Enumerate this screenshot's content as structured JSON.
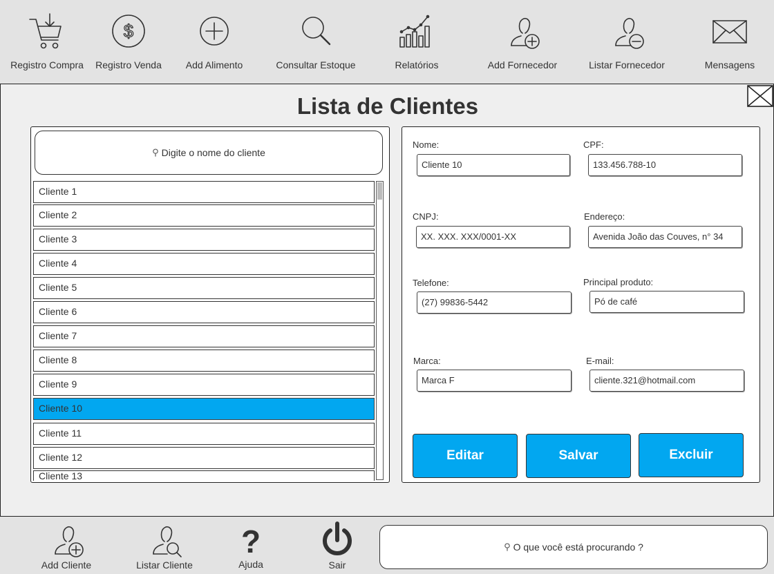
{
  "toolbar": {
    "items": [
      {
        "label": "Registro Compra",
        "icon": "cart-download-icon"
      },
      {
        "label": "Registro Venda",
        "icon": "dollar-circle-icon"
      },
      {
        "label": "Add Alimento",
        "icon": "plus-circle-icon"
      },
      {
        "label": "Consultar Estoque",
        "icon": "search-icon"
      },
      {
        "label": "Relatórios",
        "icon": "bar-chart-icon"
      },
      {
        "label": "Add Fornecedor",
        "icon": "user-add-icon"
      },
      {
        "label": "Listar Fornecedor",
        "icon": "user-remove-icon"
      },
      {
        "label": "Mensagens",
        "icon": "envelope-icon"
      }
    ]
  },
  "main": {
    "title": "Lista de Clientes",
    "close_icon": "close-envelope-icon"
  },
  "client_list": {
    "search_placeholder": "Digite o nome do cliente",
    "search_icon": "🔍",
    "items": [
      "Cliente 1",
      "Cliente 2",
      "Cliente 3",
      "Cliente 4",
      "Cliente 5",
      "Cliente 6",
      "Cliente 7",
      "Cliente 8",
      "Cliente 9",
      "Cliente 10",
      "Cliente 11",
      "Cliente 12",
      "Cliente 13"
    ],
    "selected": "Cliente 10"
  },
  "detail": {
    "nome_label": "Nome:",
    "nome_value": "Cliente 10",
    "cpf_label": "CPF:",
    "cpf_value": "133.456.788-10",
    "cnpj_label": "CNPJ:",
    "cnpj_value": "XX. XXX. XXX/0001-XX",
    "endereco_label": "Endereço:",
    "endereco_value": "Avenida João das Couves, n° 34",
    "telefone_label": "Telefone:",
    "telefone_value": "(27) 99836-5442",
    "produto_label": "Principal produto:",
    "produto_value": "Pó de café",
    "marca_label": "Marca:",
    "marca_value": "Marca F",
    "email_label": "E-mail:",
    "email_value": "cliente.321@hotmail.com",
    "edit_label": "Editar",
    "save_label": "Salvar",
    "delete_label": "Excluir"
  },
  "bottombar": {
    "items": [
      {
        "label": "Add Cliente",
        "icon": "user-add-icon"
      },
      {
        "label": "Listar Cliente",
        "icon": "user-search-icon"
      },
      {
        "label": "Ajuda",
        "icon": "question-icon"
      },
      {
        "label": "Sair",
        "icon": "power-icon"
      }
    ],
    "search_placeholder": "O que você está procurando ?"
  },
  "colors": {
    "accent": "#02a7f0",
    "background": "#e3e3e3"
  }
}
